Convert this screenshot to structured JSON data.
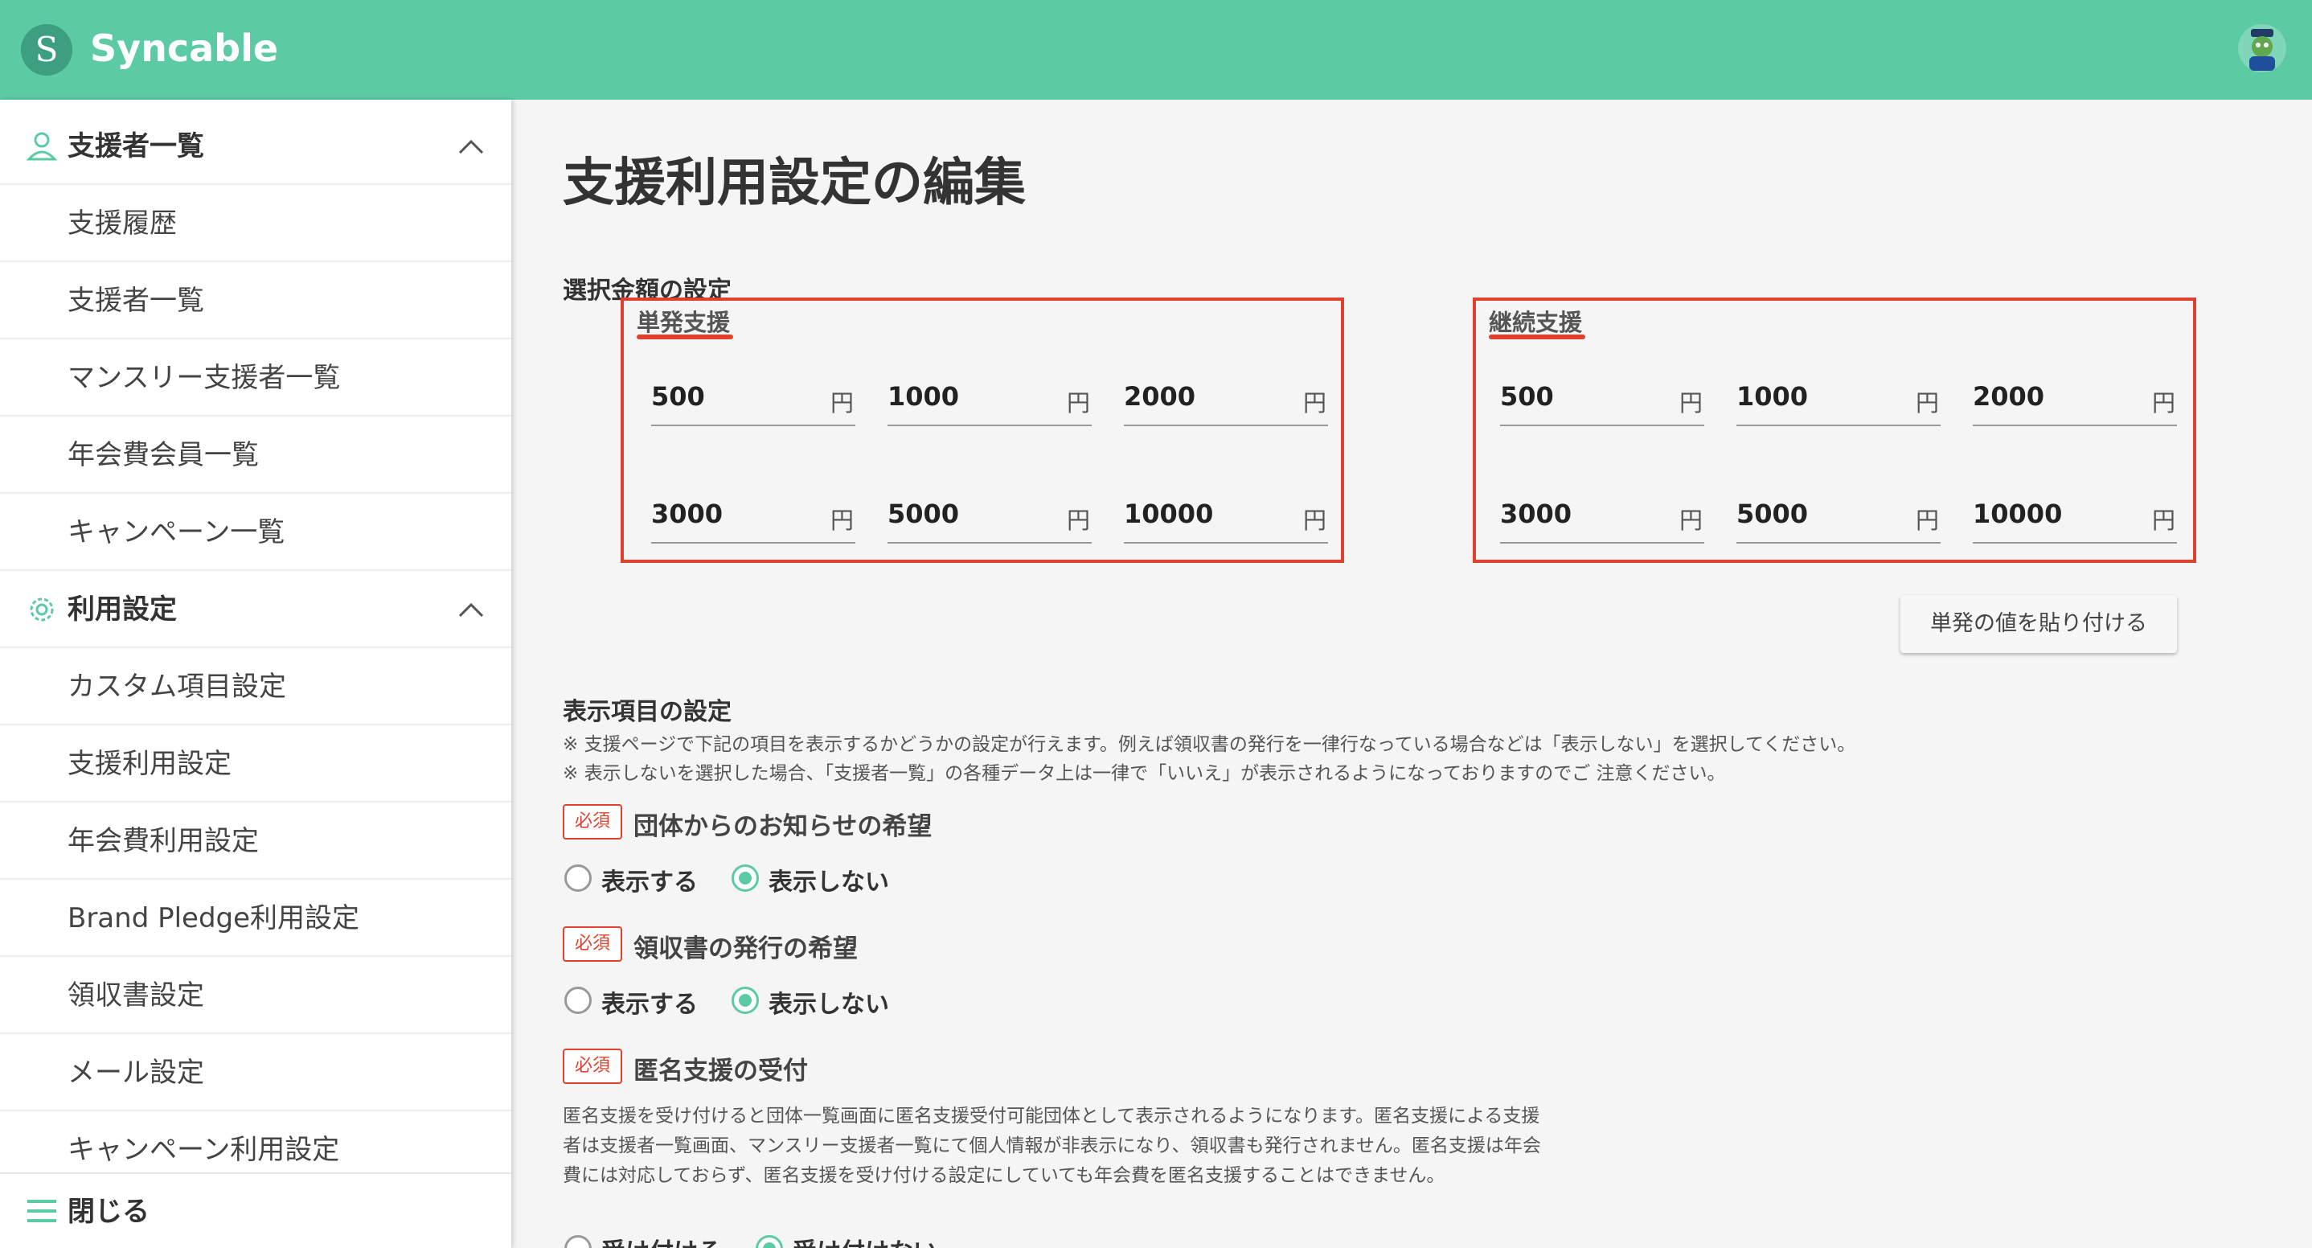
{
  "header": {
    "logo_mark": "S",
    "app_name": "Syncable",
    "brand_color": "#5ccba3",
    "avatar_icon": "user-avatar"
  },
  "sidebar": {
    "groups": [
      {
        "label": "支援者一覧",
        "icon": "person-icon",
        "items": [
          "支援履歴",
          "支援者一覧",
          "マンスリー支援者一覧",
          "年会費会員一覧",
          "キャンペーン一覧"
        ]
      },
      {
        "label": "利用設定",
        "icon": "gear-icon",
        "items": [
          "カスタム項目設定",
          "支援利用設定",
          "年会費利用設定",
          "Brand Pledge利用設定",
          "領収書設定",
          "メール設定",
          "キャンペーン利用設定"
        ]
      }
    ],
    "close_label": "閉じる"
  },
  "main": {
    "title": "支援利用設定の編集",
    "amount_section_title": "選択金額の設定",
    "one_time": {
      "label": "単発支援",
      "unit": "円",
      "amounts": [
        "500",
        "1000",
        "2000",
        "3000",
        "5000",
        "10000"
      ]
    },
    "recurring": {
      "label": "継続支援",
      "unit": "円",
      "amounts": [
        "500",
        "1000",
        "2000",
        "3000",
        "5000",
        "10000"
      ]
    },
    "paste_button": "単発の値を貼り付ける",
    "display_section_title": "表示項目の設定",
    "notes": [
      "※ 支援ページで下記の項目を表示するかどうかの設定が行えます。例えば領収書の発行を一律行なっている場合などは「表示しない」を選択してください。",
      "※ 表示しないを選択した場合、「支援者一覧」の各種データ上は一律で「いいえ」が表示されるようになっておりますのでご 注意ください。"
    ],
    "required_badge": "必須",
    "fields": [
      {
        "title": "団体からのお知らせの希望",
        "options": [
          "表示する",
          "表示しない"
        ],
        "selected": "表示しない"
      },
      {
        "title": "領収書の発行の希望",
        "options": [
          "表示する",
          "表示しない"
        ],
        "selected": "表示しない"
      },
      {
        "title": "匿名支援の受付",
        "options": [
          "受け付ける",
          "受け付けない"
        ],
        "selected": "受け付けない"
      }
    ],
    "anonymous_description": "匿名支援を受け付けると団体一覧画面に匿名支援受付可能団体として表示されるようになります。匿名支援による支援者は支援者一覧画面、マンスリー支援者一覧にて個人情報が非表示になり、領収書も発行されません。匿名支援は年会費には対応しておらず、匿名支援を受け付ける設定にしていても年会費を匿名支援することはできません。",
    "highlight_color": "#e0402e"
  }
}
